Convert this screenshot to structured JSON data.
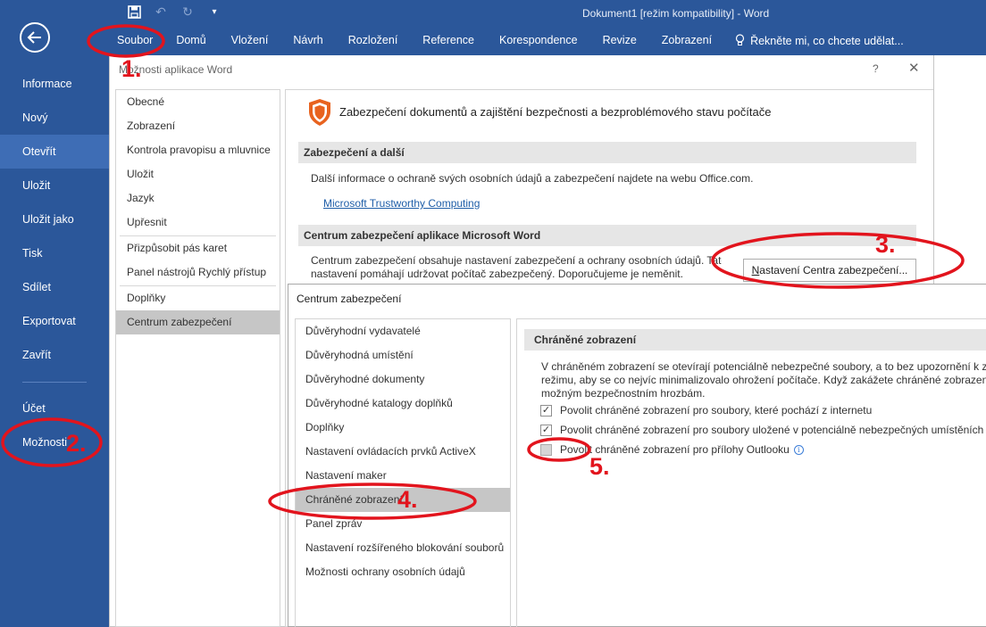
{
  "window": {
    "title": "Dokument1 [režim kompatibility] - Word"
  },
  "ribbon": {
    "tabs": [
      "Soubor",
      "Domů",
      "Vložení",
      "Návrh",
      "Rozložení",
      "Reference",
      "Korespondence",
      "Revize",
      "Zobrazení"
    ],
    "tell_me": "Řekněte mi, co chcete udělat..."
  },
  "backstage": {
    "items": [
      "Informace",
      "Nový",
      "Otevřít",
      "Uložit",
      "Uložit jako",
      "Tisk",
      "Sdílet",
      "Exportovat",
      "Zavřít",
      "Účet",
      "Možnosti"
    ],
    "active": "Otevřít"
  },
  "options_dialog": {
    "title": "Možnosti aplikace Word",
    "help": "?",
    "close": "✕",
    "nav": [
      "Obecné",
      "Zobrazení",
      "Kontrola pravopisu a mluvnice",
      "Uložit",
      "Jazyk",
      "Upřesnit",
      "Přizpůsobit pás karet",
      "Panel nástrojů Rychlý přístup",
      "Doplňky",
      "Centrum zabezpečení"
    ],
    "selected": "Centrum zabezpečení",
    "heading": "Zabezpečení dokumentů a zajištění bezpečnosti a bezproblémového stavu počítače",
    "section1": {
      "title": "Zabezpečení a další",
      "text": "Další informace o ochraně svých osobních údajů a zabezpečení najdete na webu Office.com.",
      "link": "Microsoft Trustworthy Computing"
    },
    "section2": {
      "title": "Centrum zabezpečení aplikace Microsoft Word",
      "text_line1": "Centrum zabezpečení obsahuje nastavení zabezpečení a ochrany osobních údajů. Tato",
      "text_line2": "nastavení pomáhají udržovat počítač zabezpečený. Doporučujeme je neměnit.",
      "button_mnemonic": "N",
      "button_rest": "astavení Centra zabezpečení..."
    }
  },
  "trust_center": {
    "title": "Centrum zabezpečení",
    "nav": [
      "Důvěryhodní vydavatelé",
      "Důvěryhodná umístění",
      "Důvěryhodné dokumenty",
      "Důvěryhodné katalogy doplňků",
      "Doplňky",
      "Nastavení ovládacích prvků ActiveX",
      "Nastavení maker",
      "Chráněné zobrazení",
      "Panel zpráv",
      "Nastavení rozšířeného blokování souborů",
      "Možnosti ochrany osobních údajů"
    ],
    "selected": "Chráněné zobrazení",
    "section_title": "Chráněné zobrazení",
    "desc_line1": "V chráněném zobrazení se otevírají potenciálně nebezpečné soubory, a to bez upozornění k zab",
    "desc_line2": "režimu, aby se co nejvíc minimalizovalo ohrožení počítače. Když zakážete chráněné zobrazení, n",
    "desc_line3": "možným bezpečnostním hrozbám.",
    "checkboxes": [
      {
        "label": "Povolit chráněné zobrazení pro soubory, které pochází z internetu",
        "checked": true
      },
      {
        "label": "Povolit chráněné zobrazení pro soubory uložené v potenciálně nebezpečných umístěních",
        "checked": true
      },
      {
        "label": "Povolit chráněné zobrazení pro přílohy Outlooku",
        "checked": false
      }
    ]
  },
  "annotations": {
    "color": "#e2141d",
    "steps": [
      "1.",
      "2.",
      "3.",
      "4.",
      "5."
    ]
  },
  "colors": {
    "word_blue": "#2b579a",
    "backstage_active": "#3e6db5"
  }
}
